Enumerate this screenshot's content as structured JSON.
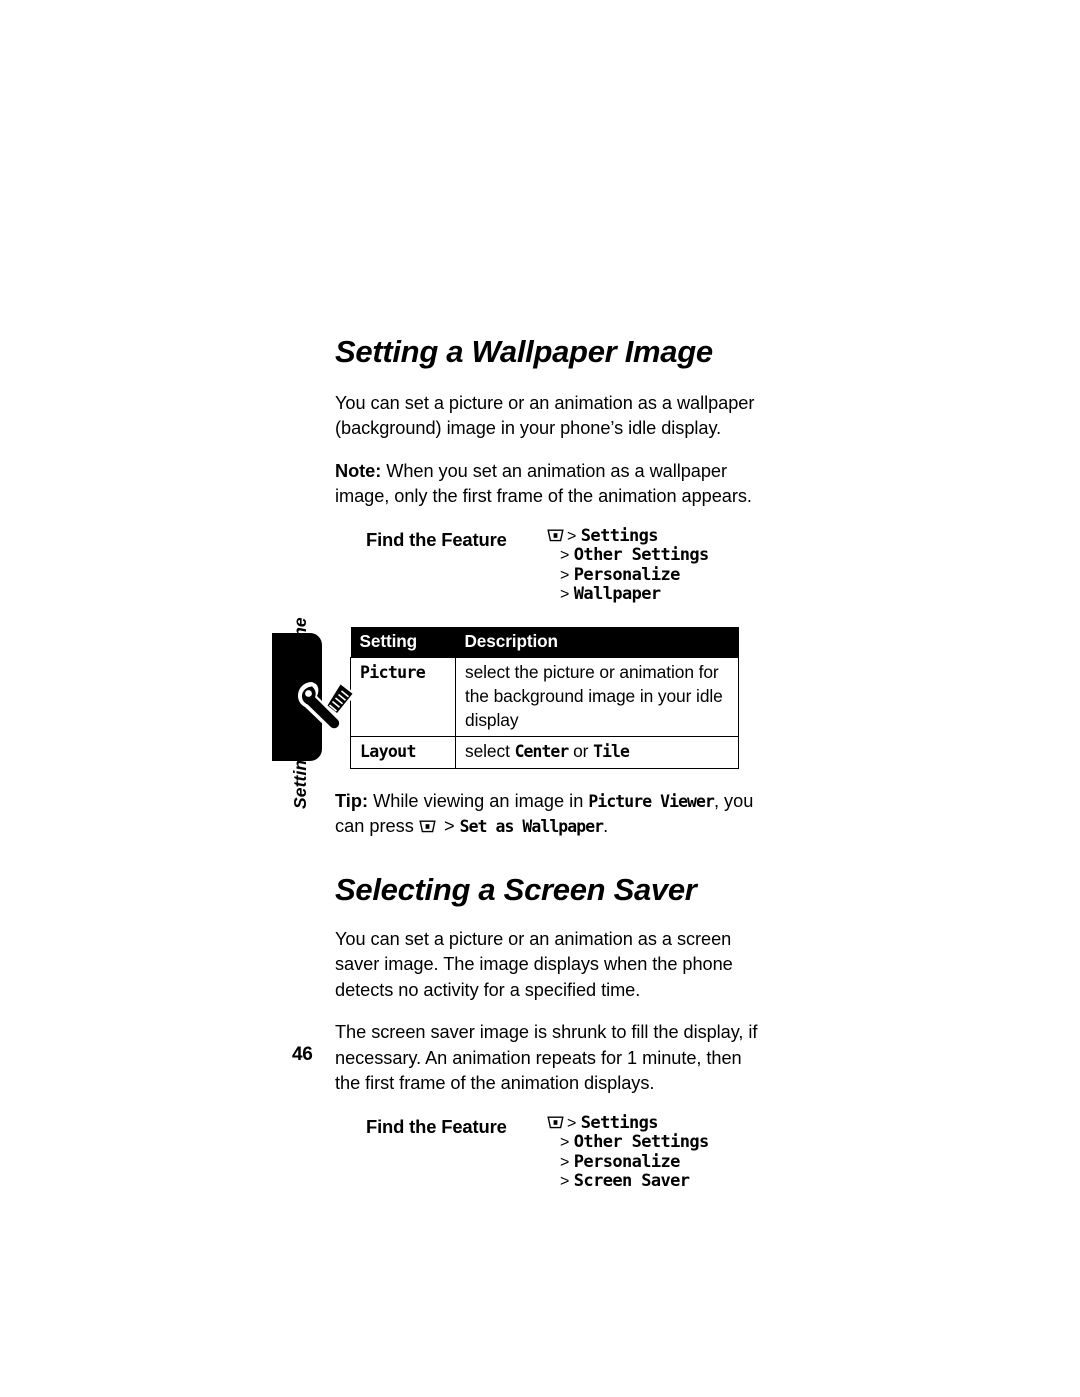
{
  "document": {
    "page_number": "46",
    "margin_tab_label": "Setting Up Your Phone",
    "tab_icon": "wrench-screwdriver-icon"
  },
  "sections": [
    {
      "title": "Setting a Wallpaper Image",
      "intro_paragraph": "You can set a picture or an animation as a wallpaper (background) image in your phone’s idle display.",
      "note_label": "Note:",
      "note_text": " When you set an animation as a wallpaper image, only the first frame of the animation appears.",
      "find_feature": {
        "label": "Find the Feature",
        "menu_icon": "menu-key-icon",
        "path": [
          {
            "arrow": ">",
            "item": "Settings",
            "first": true
          },
          {
            "arrow": ">",
            "item": "Other Settings",
            "first": false
          },
          {
            "arrow": ">",
            "item": "Personalize",
            "first": false
          },
          {
            "arrow": ">",
            "item": "Wallpaper",
            "first": false
          }
        ]
      },
      "table": {
        "headers": [
          "Setting",
          "Description"
        ],
        "rows": [
          {
            "setting": "Picture",
            "description_plain": "select the picture or animation for the background image in your idle display"
          },
          {
            "setting": "Layout",
            "description_prefix": "select ",
            "description_option_1": "Center",
            "description_middle": " or ",
            "description_option_2": "Tile"
          }
        ]
      },
      "tip": {
        "icon": "tip-pointer-icon",
        "label": "Tip:",
        "part_1": " While viewing an image in ",
        "ui_1": "Picture Viewer",
        "part_2": ", you can press ",
        "menu_icon": "menu-key-icon",
        "part_3": " > ",
        "ui_2": "Set as Wallpaper",
        "part_4": "."
      }
    },
    {
      "title": "Selecting a Screen Saver",
      "paragraph_1": "You can set a picture or an animation as a screen saver image. The image displays when the phone detects no activity for a specified time.",
      "paragraph_2": "The screen saver image is shrunk to fill the display, if necessary. An animation repeats for 1 minute, then the first frame of the animation displays.",
      "find_feature": {
        "label": "Find the Feature",
        "menu_icon": "menu-key-icon",
        "path": [
          {
            "arrow": ">",
            "item": "Settings",
            "first": true
          },
          {
            "arrow": ">",
            "item": "Other Settings",
            "first": false
          },
          {
            "arrow": ">",
            "item": "Personalize",
            "first": false
          },
          {
            "arrow": ">",
            "item": "Screen Saver",
            "first": false
          }
        ]
      }
    }
  ],
  "colors": {
    "ink": "#000000",
    "paper": "#ffffff",
    "table_header_bg": "#000000",
    "table_header_fg": "#ffffff"
  }
}
